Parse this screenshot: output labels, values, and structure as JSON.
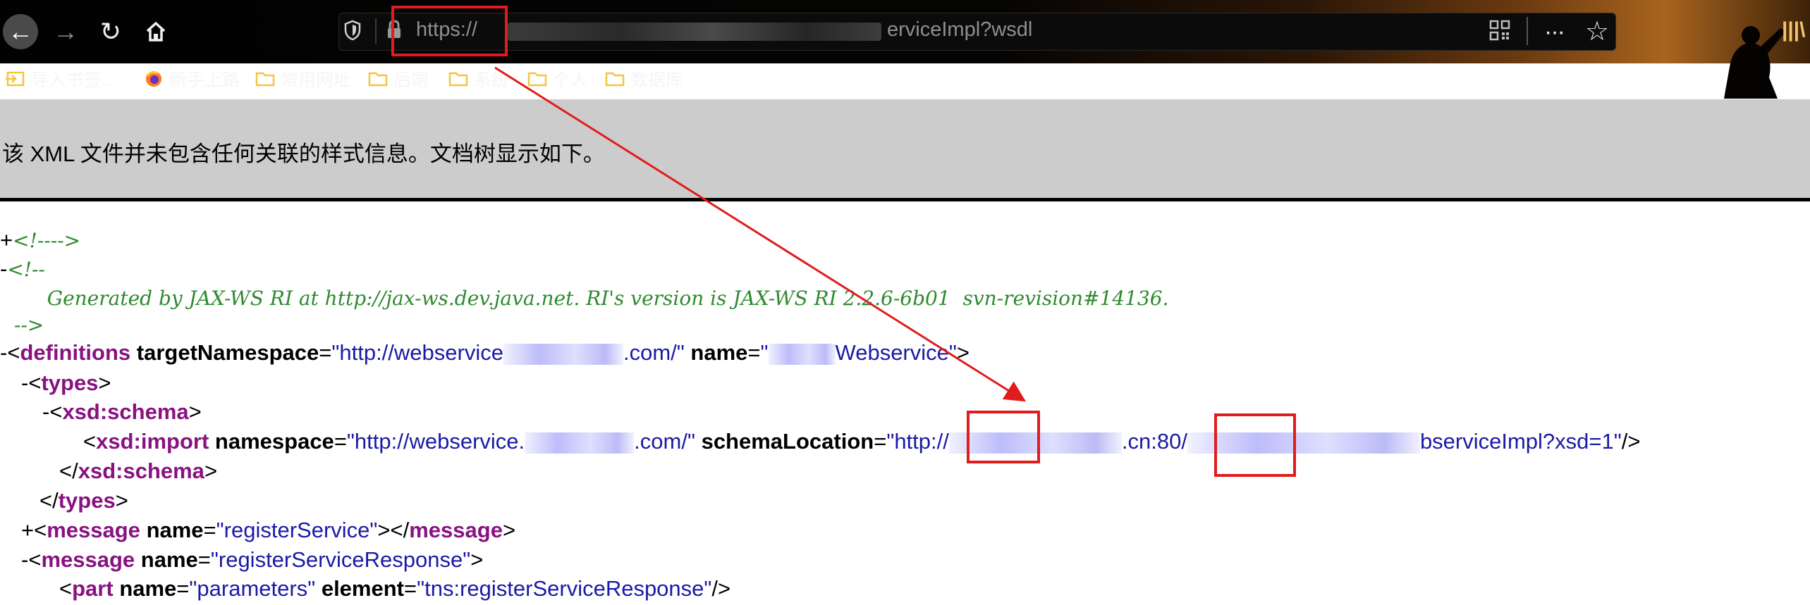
{
  "toolbar": {
    "url_scheme": "https://",
    "url_tail": "erviceImpl?wsdl",
    "more_glyph": "···",
    "star_glyph": "☆",
    "library_glyph": "|||\\"
  },
  "bookmarks": [
    {
      "label": "导入书签...",
      "icon": "import-icon"
    },
    {
      "label": "新手上路",
      "icon": "firefox-icon"
    },
    {
      "label": "常用网址",
      "icon": "folder-icon"
    },
    {
      "label": "后端",
      "icon": "folder-icon"
    },
    {
      "label": "系统",
      "icon": "folder-icon"
    },
    {
      "label": "个人",
      "icon": "folder-icon"
    },
    {
      "label": "数据库",
      "icon": "folder-icon"
    }
  ],
  "notice": "该 XML 文件并未包含任何关联的样式信息。文档树显示如下。",
  "xml": {
    "collapse_plus": "+",
    "collapse_minus": "-",
    "comment_empty": "<!---->",
    "comment_open": "<!--",
    "comment_body": "   Generated by JAX-WS RI at http://jax-ws.dev.java.net. RI's version is JAX-WS RI 2.2.6-6b01  svn-revision#14136.",
    "comment_close": "-->",
    "definitions_tag": "definitions",
    "targetNamespace_attr": "targetNamespace",
    "targetNamespace_start": "\"http://webservice",
    "targetNamespace_end": ".com/\"",
    "name_attr": "name",
    "def_name_start": "\"",
    "def_name_end": "Webservice\"",
    "types_tag": "types",
    "schema_tag": "xsd:schema",
    "import_tag": "xsd:import",
    "namespace_attr": "namespace",
    "import_ns_start": "\"http://webservice.",
    "import_ns_end": ".com/\"",
    "schemaLocation_attr": "schemaLocation",
    "schema_loc_1": "\"http://",
    "schema_loc_2": ".cn:80/",
    "schema_loc_3": "bserviceImpl?xsd=1\"",
    "message_tag": "message",
    "msg1_name": "\"registerService\"",
    "msg2_name": "\"registerServiceResponse\"",
    "part_tag": "part",
    "part_name": "\"parameters\"",
    "element_attr": "element",
    "part_element": "\"tns:registerServiceResponse\""
  },
  "annotation_color": "#e01c1c"
}
